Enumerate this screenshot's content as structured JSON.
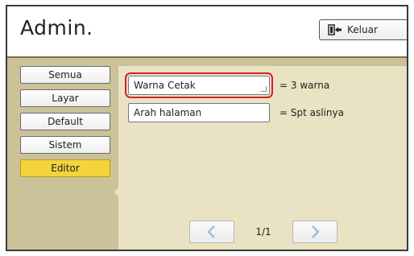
{
  "header": {
    "title": "Admin.",
    "exit_label": "Keluar"
  },
  "sidebar": {
    "items": [
      {
        "label": "Semua"
      },
      {
        "label": "Layar"
      },
      {
        "label": "Default"
      },
      {
        "label": "Sistem"
      },
      {
        "label": "Editor"
      }
    ],
    "active_index": 4
  },
  "settings": [
    {
      "label": "Warna Cetak",
      "value": "= 3 warna",
      "selected": true
    },
    {
      "label": "Arah halaman",
      "value": "= Spt aslinya",
      "selected": false
    }
  ],
  "pager": {
    "page_text": "1/1"
  },
  "colors": {
    "active_tab": "#f3d43a",
    "selection_outline": "#d4202a",
    "body_bg": "#cbc29a",
    "panel_bg": "#e9e3c4"
  },
  "icons": {
    "exit": "exit-door-icon",
    "prev": "chevron-left-icon",
    "next": "chevron-right-icon"
  }
}
